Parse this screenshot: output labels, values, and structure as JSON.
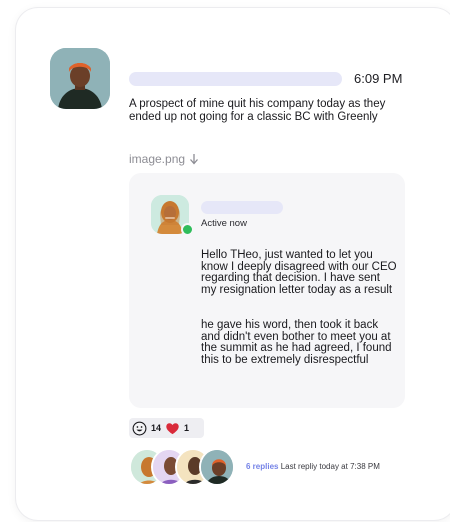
{
  "post": {
    "time": "6:09 PM",
    "message": "A prospect of mine quit his company today as they ended up not going for a classic BC with Greenly",
    "attachment_name": "image.png"
  },
  "quoted": {
    "status": "Active now",
    "paragraph_1": "Hello THeo, just wanted to let you know I deeply disagreed with our CEO regarding that decision. I have sent my resignation letter today as a result",
    "paragraph_2": "he gave his word, then took it back and didn't even bother to meet you at the summit as he had agreed, I found this to be extremely disrespectful"
  },
  "reactions": [
    {
      "icon": "grinning-face-icon",
      "count": "14"
    },
    {
      "icon": "red-heart-icon",
      "count": "1"
    }
  ],
  "thread": {
    "replies_count": "6 replies",
    "last_reply": "Last repliy today at 7:38 PM"
  },
  "colors": {
    "placeholder_bar": "#e6e7f8",
    "quoted_bg": "#f6f6f8",
    "online": "#2fbd5b",
    "link_accent": "#7583e7",
    "heart": "#d92a3a"
  }
}
